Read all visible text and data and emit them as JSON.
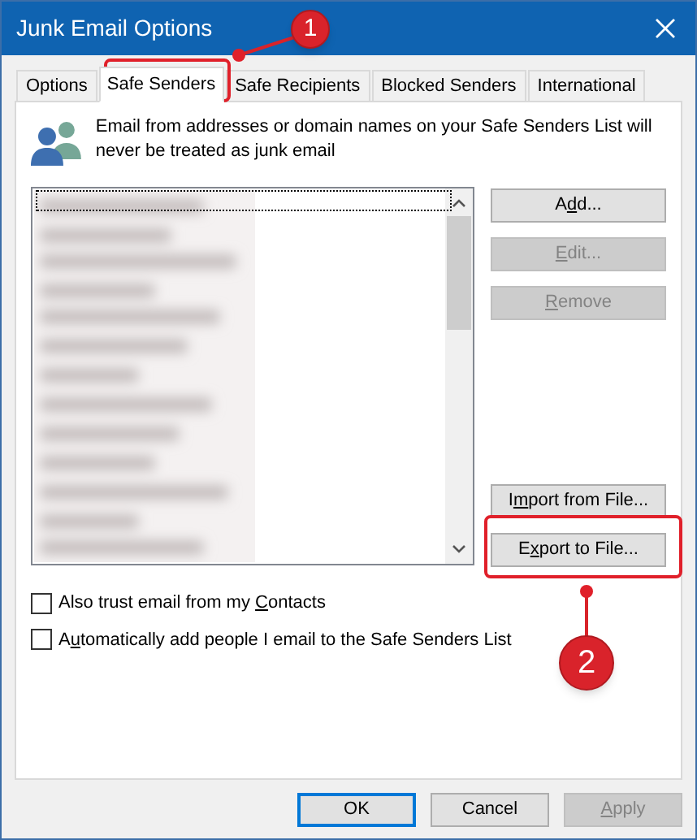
{
  "window": {
    "title": "Junk Email Options"
  },
  "tabs": [
    {
      "label": "Options",
      "selected": false
    },
    {
      "label": "Safe Senders",
      "selected": true
    },
    {
      "label": "Safe Recipients",
      "selected": false
    },
    {
      "label": "Blocked Senders",
      "selected": false
    },
    {
      "label": "International",
      "selected": false
    }
  ],
  "info": {
    "text": "Email from addresses or domain names on your Safe Senders List will never be treated as junk email"
  },
  "side_buttons": [
    {
      "label": {
        "before": "A",
        "key": "d",
        "after": "d..."
      },
      "disabled": false
    },
    {
      "label": {
        "key": "E",
        "after": "dit..."
      },
      "disabled": true
    },
    {
      "label": {
        "key": "R",
        "after": "emove"
      },
      "disabled": true
    },
    {
      "label": {
        "before": "I",
        "key": "m",
        "after": "port from File..."
      },
      "disabled": false
    },
    {
      "label": {
        "before": "E",
        "key": "x",
        "after": "port to File..."
      },
      "disabled": false
    }
  ],
  "checkboxes": [
    {
      "label": {
        "before": "Also trust email from my ",
        "key": "C",
        "after": "ontacts"
      },
      "checked": false
    },
    {
      "label": {
        "before": "A",
        "key": "u",
        "after": "tomatically add people I email to the Safe Senders List"
      },
      "checked": false
    }
  ],
  "footer_buttons": [
    {
      "label": {
        "before": "OK"
      },
      "disabled": false,
      "default": true
    },
    {
      "label": {
        "before": "Cancel"
      },
      "disabled": false,
      "default": false
    },
    {
      "label": {
        "key": "A",
        "after": "pply"
      },
      "disabled": true,
      "default": false
    }
  ],
  "annotations": [
    {
      "label": "1"
    },
    {
      "label": "2"
    }
  ]
}
